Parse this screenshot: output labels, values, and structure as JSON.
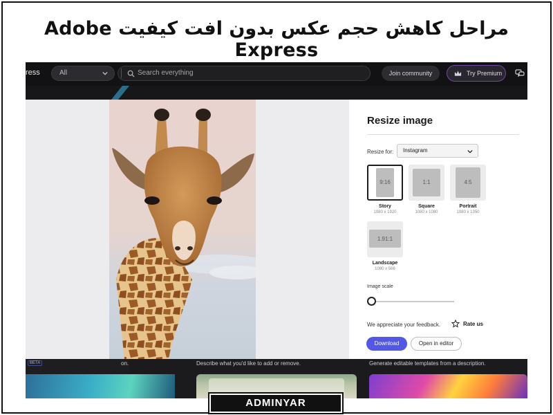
{
  "headline": "مراحل کاهش حجم عکس بدون افت کیفیت Adobe Express",
  "watermark": "ADMINYAR",
  "app": {
    "brand_fragment": "ress",
    "filter": {
      "value": "All"
    },
    "search": {
      "placeholder": "Search everything"
    },
    "join_label": "Join community",
    "premium_label": "Try Premium"
  },
  "panel": {
    "title": "Resize image",
    "resize_for_label": "Resize for:",
    "resize_for_value": "Instagram",
    "options": [
      {
        "ratio": "9:16",
        "name": "Story",
        "dims": "1080 x 1920",
        "selected": true
      },
      {
        "ratio": "1:1",
        "name": "Square",
        "dims": "1080 x 1080",
        "selected": false
      },
      {
        "ratio": "4:5",
        "name": "Portrait",
        "dims": "1080 x 1350",
        "selected": false
      },
      {
        "ratio": "1.91:1",
        "name": "Landscape",
        "dims": "1080 x 566",
        "selected": false
      }
    ],
    "scale_label": "Image scale",
    "scale_value": 0,
    "feedback_text": "We appreciate your feedback.",
    "rate_label": "Rate us",
    "download_label": "Download",
    "editor_label": "Open in editor"
  },
  "bottom": {
    "beta_label": "BETA",
    "card1_text": "on.",
    "card2_text": "Describe what you'd like to add or remove.",
    "card3_text": "Generate editable templates from a description."
  },
  "colors": {
    "accent": "#5258e4",
    "arrow": "#e8262b",
    "premium_border": "#6f4aa8"
  },
  "icons": {
    "search": "search-icon",
    "chevron": "chevron-down-icon",
    "crown": "crown-icon",
    "chat": "chat-icon",
    "star": "star-icon",
    "arrow": "red-arrow-icon"
  }
}
